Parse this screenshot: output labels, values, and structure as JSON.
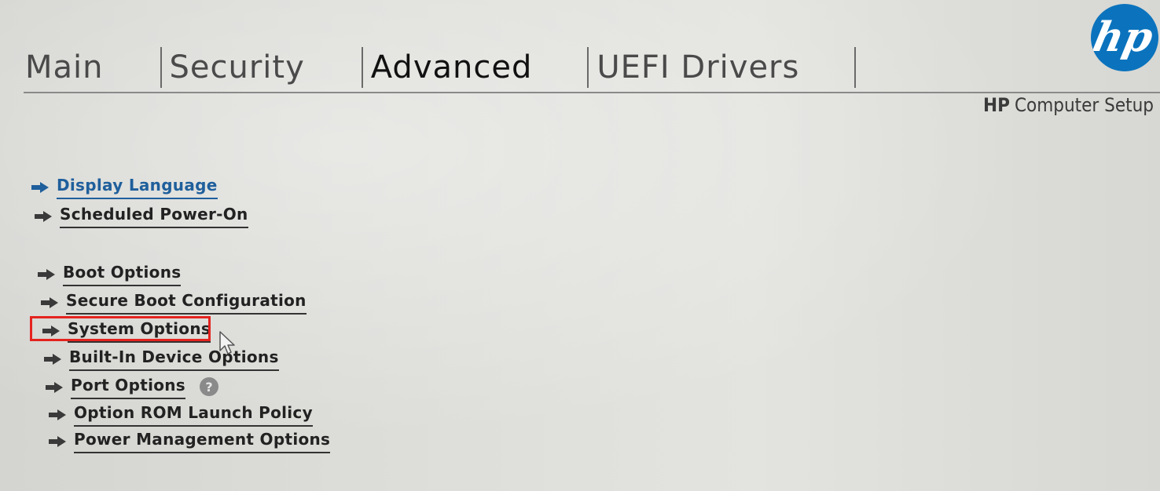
{
  "tabs": [
    {
      "label": "Main"
    },
    {
      "label": "Security"
    },
    {
      "label": "Advanced",
      "active": true
    },
    {
      "label": "UEFI Drivers"
    }
  ],
  "brand": {
    "logo_text": "hp",
    "title_bold": "HP",
    "title_rest": "Computer Setup"
  },
  "menu": {
    "items": [
      {
        "label": "Display Language",
        "selected": true
      },
      {
        "label": "Scheduled Power-On"
      },
      {
        "label": "Boot Options"
      },
      {
        "label": "Secure Boot Configuration"
      },
      {
        "label": "System Options",
        "highlighted": true
      },
      {
        "label": "Built-In Device Options"
      },
      {
        "label": "Port Options",
        "help_icon": "?"
      },
      {
        "label": "Option ROM Launch Policy"
      },
      {
        "label": "Power Management Options"
      }
    ]
  },
  "colors": {
    "selected_item": "#1f5f9c",
    "highlight_box": "#e5231f",
    "hp_logo": "#0b73bd"
  },
  "icons": {
    "menu_arrow": "arrow-right-icon",
    "help": "help-icon",
    "pointer": "mouse-pointer-icon"
  }
}
